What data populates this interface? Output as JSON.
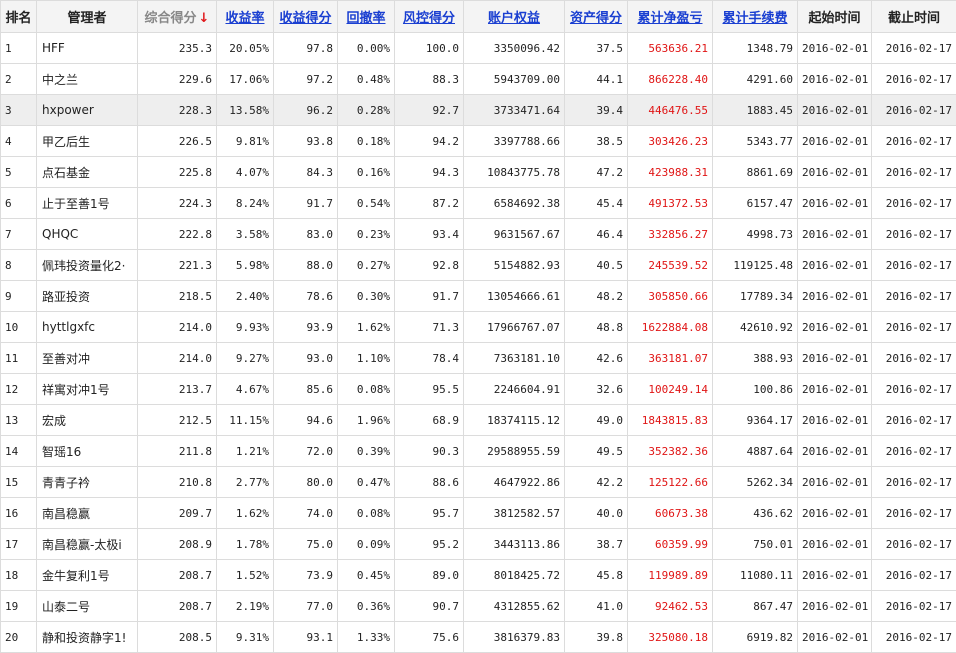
{
  "headers": {
    "rank": "排名",
    "manager": "管理者",
    "score": "综合得分",
    "score_arrow": "↓",
    "return_rate": "收益率",
    "return_score": "收益得分",
    "drawdown": "回撤率",
    "risk_score": "风控得分",
    "equity": "账户权益",
    "asset_score": "资产得分",
    "net_pnl": "累计净盈亏",
    "fees": "累计手续费",
    "start": "起始时间",
    "end": "截止时间"
  },
  "colors": {
    "link": "#1a3fd1",
    "profit": "#e01515",
    "highlight_row": "#eeeeee"
  },
  "highlighted_row": 3,
  "rows": [
    {
      "rank": "1",
      "manager": "HFF",
      "score": "235.3",
      "return_rate": "20.05%",
      "return_score": "97.8",
      "drawdown": "0.00%",
      "risk_score": "100.0",
      "equity": "3350096.42",
      "asset_score": "37.5",
      "net_pnl": "563636.21",
      "fees": "1348.79",
      "start": "2016-02-01",
      "end": "2016-02-17"
    },
    {
      "rank": "2",
      "manager": "中之兰",
      "score": "229.6",
      "return_rate": "17.06%",
      "return_score": "97.2",
      "drawdown": "0.48%",
      "risk_score": "88.3",
      "equity": "5943709.00",
      "asset_score": "44.1",
      "net_pnl": "866228.40",
      "fees": "4291.60",
      "start": "2016-02-01",
      "end": "2016-02-17"
    },
    {
      "rank": "3",
      "manager": "hxpower",
      "score": "228.3",
      "return_rate": "13.58%",
      "return_score": "96.2",
      "drawdown": "0.28%",
      "risk_score": "92.7",
      "equity": "3733471.64",
      "asset_score": "39.4",
      "net_pnl": "446476.55",
      "fees": "1883.45",
      "start": "2016-02-01",
      "end": "2016-02-17"
    },
    {
      "rank": "4",
      "manager": "甲乙后生",
      "score": "226.5",
      "return_rate": "9.81%",
      "return_score": "93.8",
      "drawdown": "0.18%",
      "risk_score": "94.2",
      "equity": "3397788.66",
      "asset_score": "38.5",
      "net_pnl": "303426.23",
      "fees": "5343.77",
      "start": "2016-02-01",
      "end": "2016-02-17"
    },
    {
      "rank": "5",
      "manager": "点石基金",
      "score": "225.8",
      "return_rate": "4.07%",
      "return_score": "84.3",
      "drawdown": "0.16%",
      "risk_score": "94.3",
      "equity": "10843775.78",
      "asset_score": "47.2",
      "net_pnl": "423988.31",
      "fees": "8861.69",
      "start": "2016-02-01",
      "end": "2016-02-17"
    },
    {
      "rank": "6",
      "manager": "止于至善1号",
      "score": "224.3",
      "return_rate": "8.24%",
      "return_score": "91.7",
      "drawdown": "0.54%",
      "risk_score": "87.2",
      "equity": "6584692.38",
      "asset_score": "45.4",
      "net_pnl": "491372.53",
      "fees": "6157.47",
      "start": "2016-02-01",
      "end": "2016-02-17"
    },
    {
      "rank": "7",
      "manager": "QHQC",
      "score": "222.8",
      "return_rate": "3.58%",
      "return_score": "83.0",
      "drawdown": "0.23%",
      "risk_score": "93.4",
      "equity": "9631567.67",
      "asset_score": "46.4",
      "net_pnl": "332856.27",
      "fees": "4998.73",
      "start": "2016-02-01",
      "end": "2016-02-17"
    },
    {
      "rank": "8",
      "manager": "佩玮投资量化2·",
      "score": "221.3",
      "return_rate": "5.98%",
      "return_score": "88.0",
      "drawdown": "0.27%",
      "risk_score": "92.8",
      "equity": "5154882.93",
      "asset_score": "40.5",
      "net_pnl": "245539.52",
      "fees": "119125.48",
      "start": "2016-02-01",
      "end": "2016-02-17"
    },
    {
      "rank": "9",
      "manager": "路亚投资",
      "score": "218.5",
      "return_rate": "2.40%",
      "return_score": "78.6",
      "drawdown": "0.30%",
      "risk_score": "91.7",
      "equity": "13054666.61",
      "asset_score": "48.2",
      "net_pnl": "305850.66",
      "fees": "17789.34",
      "start": "2016-02-01",
      "end": "2016-02-17"
    },
    {
      "rank": "10",
      "manager": "hyttlgxfc",
      "score": "214.0",
      "return_rate": "9.93%",
      "return_score": "93.9",
      "drawdown": "1.62%",
      "risk_score": "71.3",
      "equity": "17966767.07",
      "asset_score": "48.8",
      "net_pnl": "1622884.08",
      "fees": "42610.92",
      "start": "2016-02-01",
      "end": "2016-02-17"
    },
    {
      "rank": "11",
      "manager": "至善对冲",
      "score": "214.0",
      "return_rate": "9.27%",
      "return_score": "93.0",
      "drawdown": "1.10%",
      "risk_score": "78.4",
      "equity": "7363181.10",
      "asset_score": "42.6",
      "net_pnl": "363181.07",
      "fees": "388.93",
      "start": "2016-02-01",
      "end": "2016-02-17"
    },
    {
      "rank": "12",
      "manager": "祥寓对冲1号",
      "score": "213.7",
      "return_rate": "4.67%",
      "return_score": "85.6",
      "drawdown": "0.08%",
      "risk_score": "95.5",
      "equity": "2246604.91",
      "asset_score": "32.6",
      "net_pnl": "100249.14",
      "fees": "100.86",
      "start": "2016-02-01",
      "end": "2016-02-17"
    },
    {
      "rank": "13",
      "manager": "宏成",
      "score": "212.5",
      "return_rate": "11.15%",
      "return_score": "94.6",
      "drawdown": "1.96%",
      "risk_score": "68.9",
      "equity": "18374115.12",
      "asset_score": "49.0",
      "net_pnl": "1843815.83",
      "fees": "9364.17",
      "start": "2016-02-01",
      "end": "2016-02-17"
    },
    {
      "rank": "14",
      "manager": "智瑶16",
      "score": "211.8",
      "return_rate": "1.21%",
      "return_score": "72.0",
      "drawdown": "0.39%",
      "risk_score": "90.3",
      "equity": "29588955.59",
      "asset_score": "49.5",
      "net_pnl": "352382.36",
      "fees": "4887.64",
      "start": "2016-02-01",
      "end": "2016-02-17"
    },
    {
      "rank": "15",
      "manager": "青青子衿",
      "score": "210.8",
      "return_rate": "2.77%",
      "return_score": "80.0",
      "drawdown": "0.47%",
      "risk_score": "88.6",
      "equity": "4647922.86",
      "asset_score": "42.2",
      "net_pnl": "125122.66",
      "fees": "5262.34",
      "start": "2016-02-01",
      "end": "2016-02-17"
    },
    {
      "rank": "16",
      "manager": "南昌稳赢",
      "score": "209.7",
      "return_rate": "1.62%",
      "return_score": "74.0",
      "drawdown": "0.08%",
      "risk_score": "95.7",
      "equity": "3812582.57",
      "asset_score": "40.0",
      "net_pnl": "60673.38",
      "fees": "436.62",
      "start": "2016-02-01",
      "end": "2016-02-17"
    },
    {
      "rank": "17",
      "manager": "南昌稳赢-太极i",
      "score": "208.9",
      "return_rate": "1.78%",
      "return_score": "75.0",
      "drawdown": "0.09%",
      "risk_score": "95.2",
      "equity": "3443113.86",
      "asset_score": "38.7",
      "net_pnl": "60359.99",
      "fees": "750.01",
      "start": "2016-02-01",
      "end": "2016-02-17"
    },
    {
      "rank": "18",
      "manager": "金牛复利1号",
      "score": "208.7",
      "return_rate": "1.52%",
      "return_score": "73.9",
      "drawdown": "0.45%",
      "risk_score": "89.0",
      "equity": "8018425.72",
      "asset_score": "45.8",
      "net_pnl": "119989.89",
      "fees": "11080.11",
      "start": "2016-02-01",
      "end": "2016-02-17"
    },
    {
      "rank": "19",
      "manager": "山泰二号",
      "score": "208.7",
      "return_rate": "2.19%",
      "return_score": "77.0",
      "drawdown": "0.36%",
      "risk_score": "90.7",
      "equity": "4312855.62",
      "asset_score": "41.0",
      "net_pnl": "92462.53",
      "fees": "867.47",
      "start": "2016-02-01",
      "end": "2016-02-17"
    },
    {
      "rank": "20",
      "manager": "静和投资静字1!",
      "score": "208.5",
      "return_rate": "9.31%",
      "return_score": "93.1",
      "drawdown": "1.33%",
      "risk_score": "75.6",
      "equity": "3816379.83",
      "asset_score": "39.8",
      "net_pnl": "325080.18",
      "fees": "6919.82",
      "start": "2016-02-01",
      "end": "2016-02-17"
    }
  ]
}
